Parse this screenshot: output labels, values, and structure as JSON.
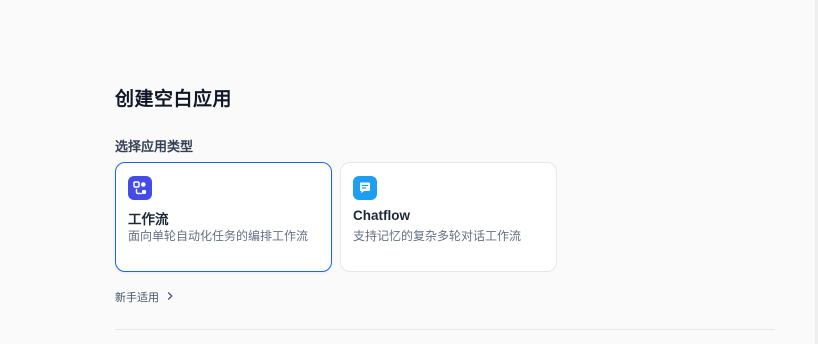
{
  "page": {
    "title": "创建空白应用"
  },
  "app_type_section": {
    "label": "选择应用类型",
    "cards": [
      {
        "title": "工作流",
        "description": "面向单轮自动化任务的编排工作流",
        "icon": "workflow-icon",
        "icon_color": "#444ce7",
        "selected": true
      },
      {
        "title": "Chatflow",
        "description": "支持记忆的复杂多轮对话工作流",
        "icon": "chatflow-icon",
        "icon_color": "#1e9ef0",
        "selected": false
      }
    ]
  },
  "starter_link": {
    "label": "新手适用",
    "icon": "chevron-right-icon"
  },
  "colors": {
    "accent": "#1d64e8"
  }
}
